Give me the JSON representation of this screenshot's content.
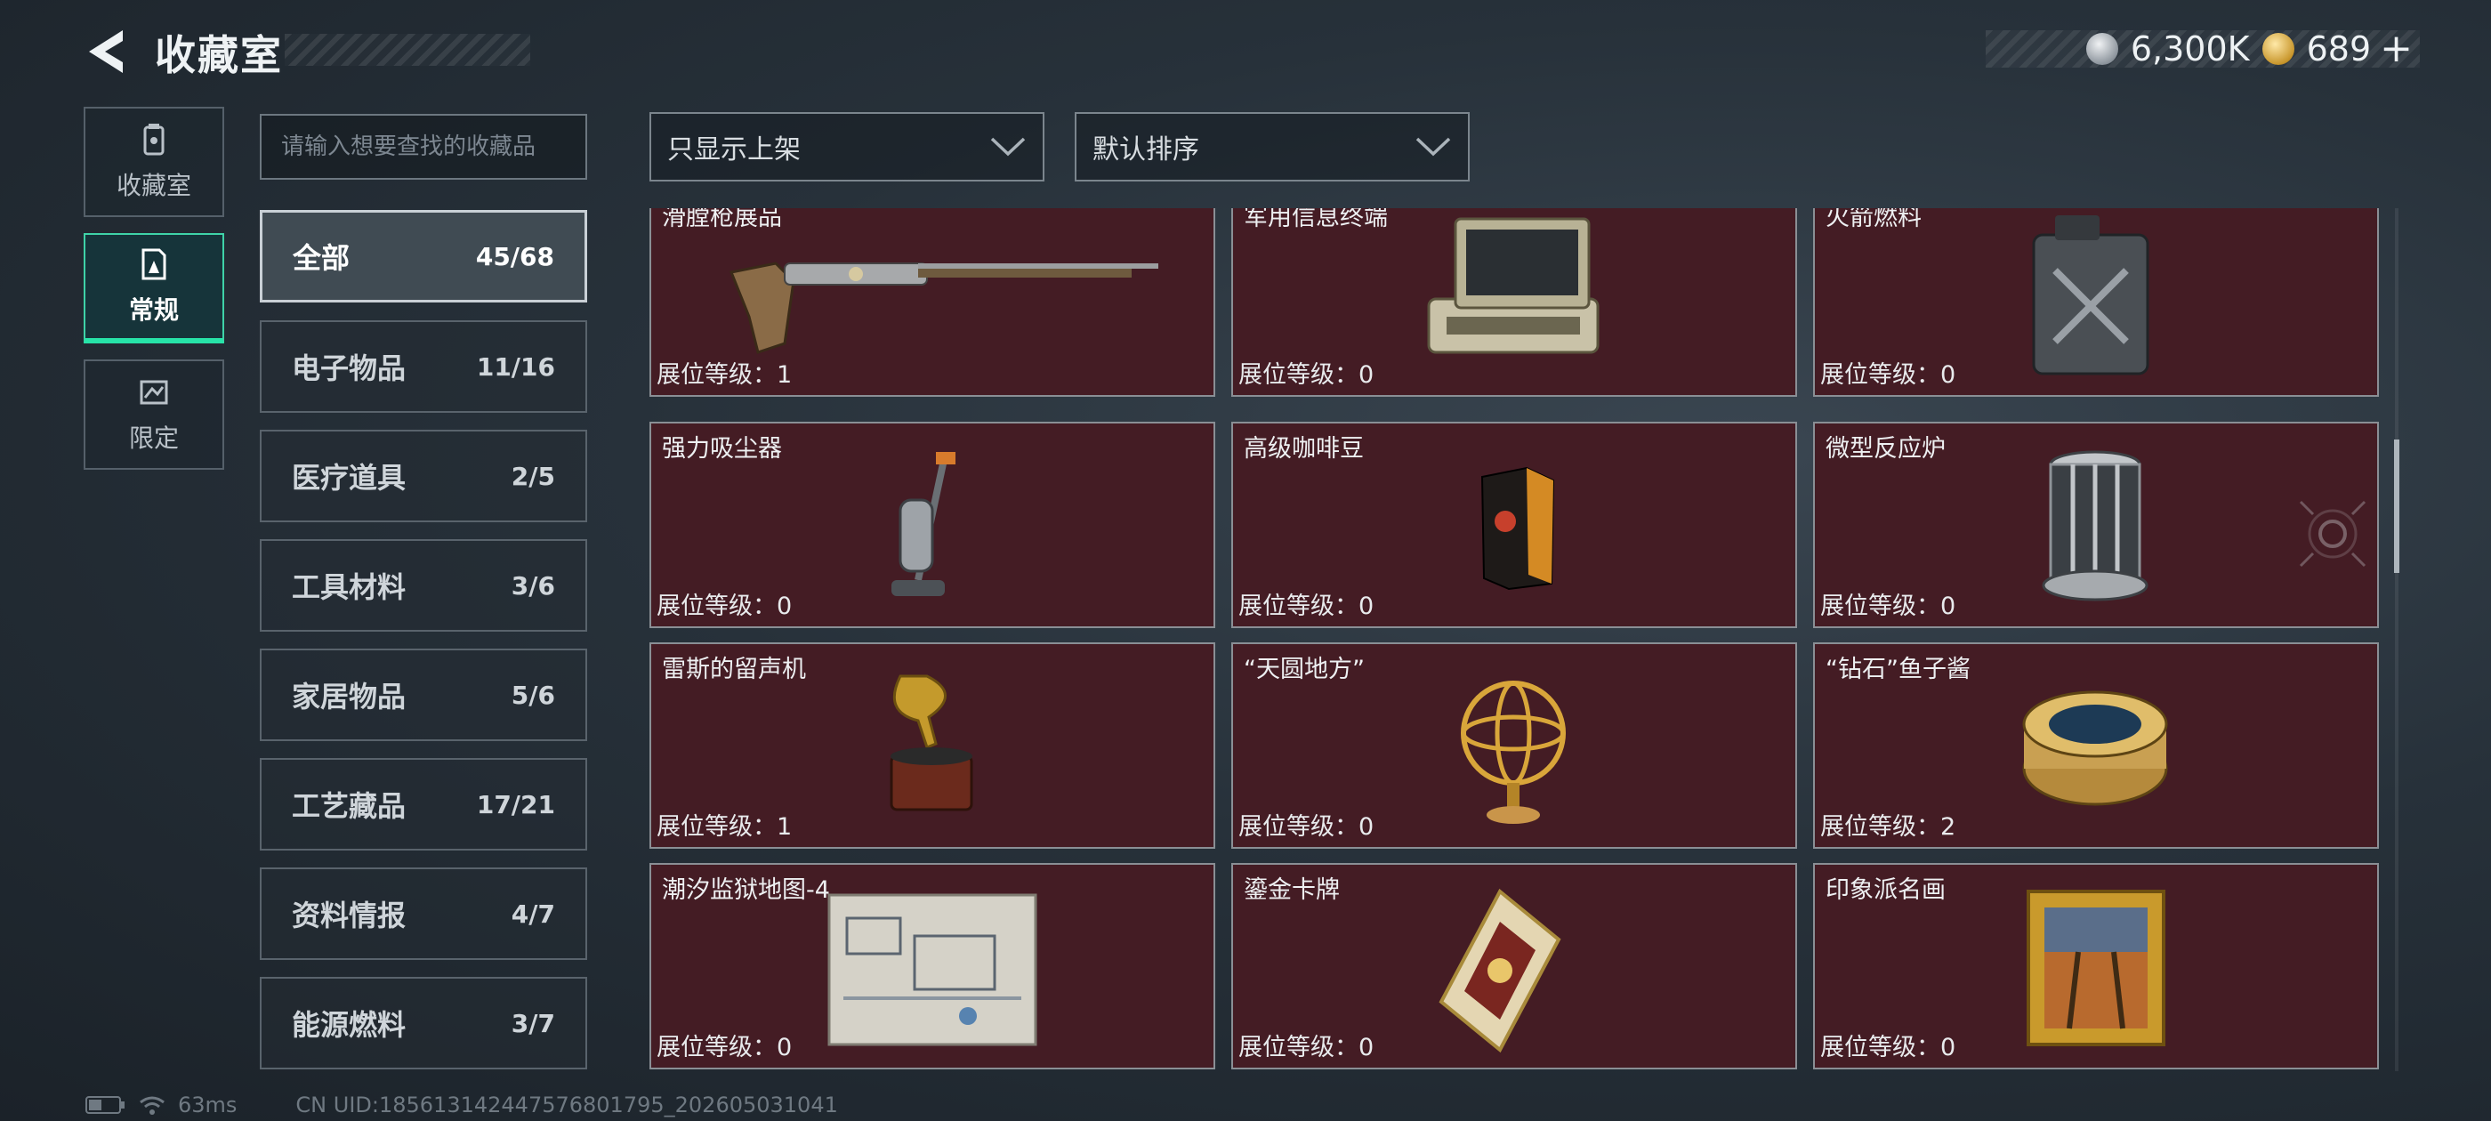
{
  "header": {
    "title": "收藏室",
    "currencies": [
      {
        "icon": "silver-coin-icon",
        "value": "6,300K"
      },
      {
        "icon": "gold-coin-icon",
        "value": "689"
      }
    ],
    "add_label": "+"
  },
  "mode_tabs": [
    {
      "label": "收藏室",
      "icon": "collection-room-icon",
      "active": false
    },
    {
      "label": "常规",
      "icon": "regular-icon",
      "active": true
    },
    {
      "label": "限定",
      "icon": "limited-icon",
      "active": false
    }
  ],
  "search": {
    "placeholder": "请输入想要查找的收藏品"
  },
  "filters": {
    "display_filter": "只显示上架",
    "sort": "默认排序"
  },
  "categories": [
    {
      "name": "全部",
      "count": "45/68",
      "active": true
    },
    {
      "name": "电子物品",
      "count": "11/16"
    },
    {
      "name": "医疗道具",
      "count": "2/5"
    },
    {
      "name": "工具材料",
      "count": "3/6"
    },
    {
      "name": "家居物品",
      "count": "5/6"
    },
    {
      "name": "工艺藏品",
      "count": "17/21"
    },
    {
      "name": "资料情报",
      "count": "4/7"
    },
    {
      "name": "能源燃料",
      "count": "3/7"
    }
  ],
  "level_prefix": "展位等级：",
  "items": [
    {
      "name": "滑膛枪展品",
      "level": "1",
      "art": "musket"
    },
    {
      "name": "军用信息终端",
      "level": "0",
      "art": "terminal"
    },
    {
      "name": "火箭燃料",
      "level": "0",
      "art": "jerrycan"
    },
    {
      "name": "强力吸尘器",
      "level": "0",
      "art": "vacuum"
    },
    {
      "name": "高级咖啡豆",
      "level": "0",
      "art": "coffee"
    },
    {
      "name": "微型反应炉",
      "level": "0",
      "art": "reactor"
    },
    {
      "name": "雷斯的留声机",
      "level": "1",
      "art": "gramophone"
    },
    {
      "name": "“天圆地方”",
      "level": "0",
      "art": "armillary"
    },
    {
      "name": "“钻石”鱼子酱",
      "level": "2",
      "art": "caviar"
    },
    {
      "name": "潮汐监狱地图-4",
      "level": "0",
      "art": "map"
    },
    {
      "name": "鎏金卡牌",
      "level": "0",
      "art": "card"
    },
    {
      "name": "印象派名画",
      "level": "0",
      "art": "painting"
    }
  ],
  "status": {
    "ping": "63ms",
    "uid": "CN UID:185613142447576801795_202605031041"
  }
}
